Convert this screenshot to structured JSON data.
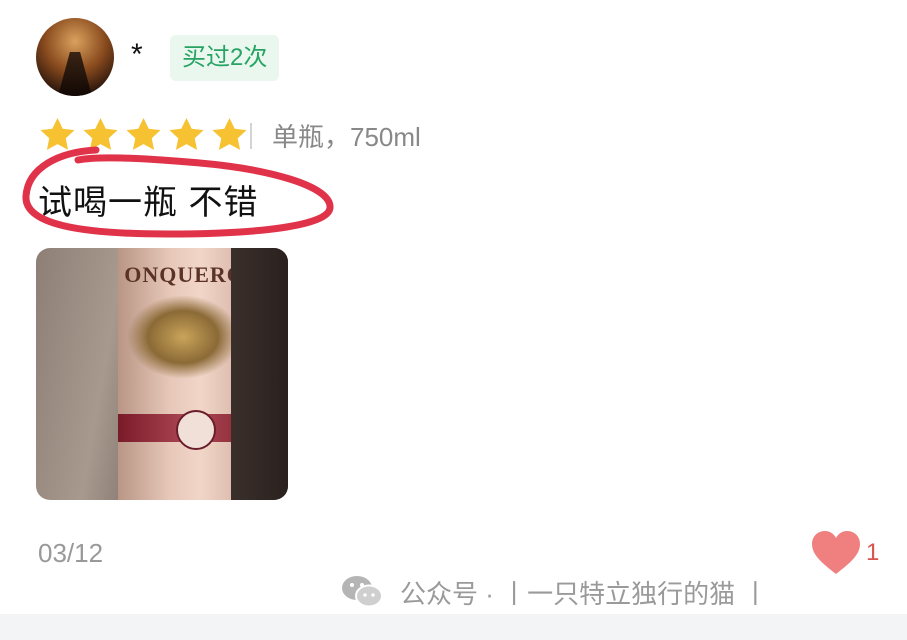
{
  "user": {
    "name": "*",
    "badge": "买过2次"
  },
  "rating": {
    "stars": 5,
    "max": 5,
    "star_color": "#f6c232"
  },
  "spec": "单瓶，750ml",
  "review_text": "试喝一瓶 不错",
  "photo": {
    "bottle_label": "ONQUEROR"
  },
  "date": "03/12",
  "likes": {
    "count": "1",
    "color": "#f08080"
  },
  "watermark": {
    "text": "公众号 · 丨一只特立独行的猫 丨"
  },
  "colors": {
    "badge_text": "#27a363",
    "badge_bg": "#eaf7ef",
    "annotation": "#e0334a"
  }
}
